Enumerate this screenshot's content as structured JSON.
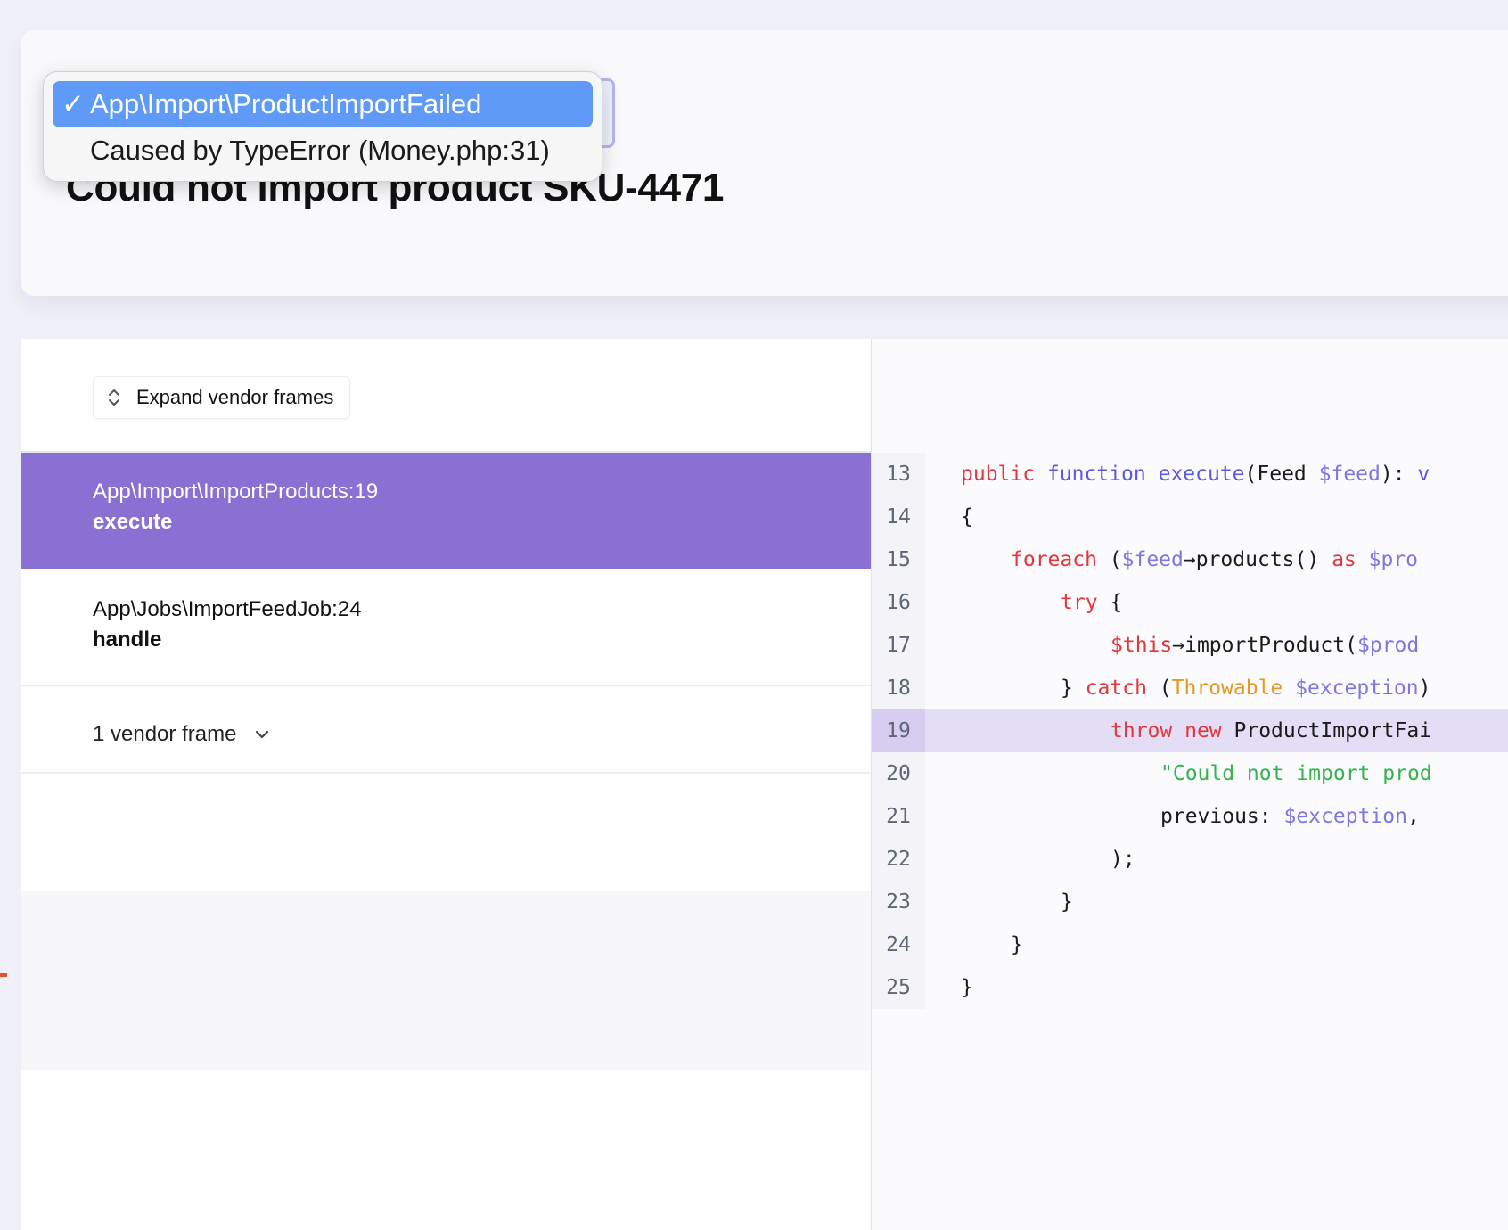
{
  "header": {
    "exception_message": "Could not import product SKU-4471"
  },
  "exception_selector": {
    "options": [
      {
        "label": "App\\Import\\ProductImportFailed",
        "selected": true
      },
      {
        "label": "Caused by TypeError (Money.php:31)",
        "selected": false
      }
    ]
  },
  "frames_toolbar": {
    "expand_label": "Expand vendor frames"
  },
  "frames": [
    {
      "class": "App\\Import\\ImportProducts",
      "line": "19",
      "method": "execute",
      "active": true
    },
    {
      "class": "App\\Jobs\\ImportFeedJob",
      "line": "24",
      "method": "handle",
      "active": false
    }
  ],
  "vendor_toggle": {
    "label": "1 vendor frame"
  },
  "code": {
    "highlighted_line": 19,
    "lines": [
      {
        "n": "13",
        "indent": 0,
        "tokens": [
          [
            "kw",
            "public"
          ],
          [
            "",
            " "
          ],
          [
            "fn",
            "function"
          ],
          [
            "",
            " "
          ],
          [
            "fn",
            "execute"
          ],
          [
            "",
            "(Feed "
          ],
          [
            "var",
            "$feed"
          ],
          [
            "",
            "): "
          ],
          [
            "fn",
            "v"
          ]
        ]
      },
      {
        "n": "14",
        "indent": 0,
        "tokens": [
          [
            "",
            "{"
          ]
        ]
      },
      {
        "n": "15",
        "indent": 1,
        "tokens": [
          [
            "kw",
            "foreach"
          ],
          [
            "",
            " ("
          ],
          [
            "var",
            "$feed"
          ],
          [
            "",
            "→products() "
          ],
          [
            "kw",
            "as"
          ],
          [
            "",
            " "
          ],
          [
            "var",
            "$pro"
          ]
        ]
      },
      {
        "n": "16",
        "indent": 2,
        "tokens": [
          [
            "kw",
            "try"
          ],
          [
            "",
            " {"
          ]
        ]
      },
      {
        "n": "17",
        "indent": 3,
        "tokens": [
          [
            "kw",
            "$this"
          ],
          [
            "",
            "→importProduct("
          ],
          [
            "var",
            "$prod"
          ]
        ]
      },
      {
        "n": "18",
        "indent": 2,
        "tokens": [
          [
            "",
            "} "
          ],
          [
            "kw",
            "catch"
          ],
          [
            "",
            " ("
          ],
          [
            "ty",
            "Throwable"
          ],
          [
            "",
            " "
          ],
          [
            "var",
            "$exception"
          ],
          [
            "",
            ")"
          ]
        ]
      },
      {
        "n": "19",
        "indent": 3,
        "tokens": [
          [
            "kw",
            "throw"
          ],
          [
            "",
            " "
          ],
          [
            "kw",
            "new"
          ],
          [
            "",
            " ProductImportFai"
          ]
        ]
      },
      {
        "n": "20",
        "indent": 4,
        "tokens": [
          [
            "str",
            "\"Could not import prod"
          ]
        ]
      },
      {
        "n": "21",
        "indent": 4,
        "tokens": [
          [
            "",
            "previous: "
          ],
          [
            "var",
            "$exception"
          ],
          [
            "",
            ","
          ]
        ]
      },
      {
        "n": "22",
        "indent": 3,
        "tokens": [
          [
            "",
            ");"
          ]
        ]
      },
      {
        "n": "23",
        "indent": 2,
        "tokens": [
          [
            "",
            "}"
          ]
        ]
      },
      {
        "n": "24",
        "indent": 1,
        "tokens": [
          [
            "",
            "}"
          ]
        ]
      },
      {
        "n": "25",
        "indent": 0,
        "tokens": [
          [
            "",
            "}"
          ]
        ]
      }
    ]
  },
  "colors": {
    "active_frame": "#8b70d4",
    "dropdown_selected": "#5f9af8",
    "keyword": "#e1373c",
    "function": "#5d58e0",
    "variable": "#7d77e2",
    "type": "#e49a21",
    "string": "#36b34f",
    "highlight_line": "#e3def5"
  }
}
